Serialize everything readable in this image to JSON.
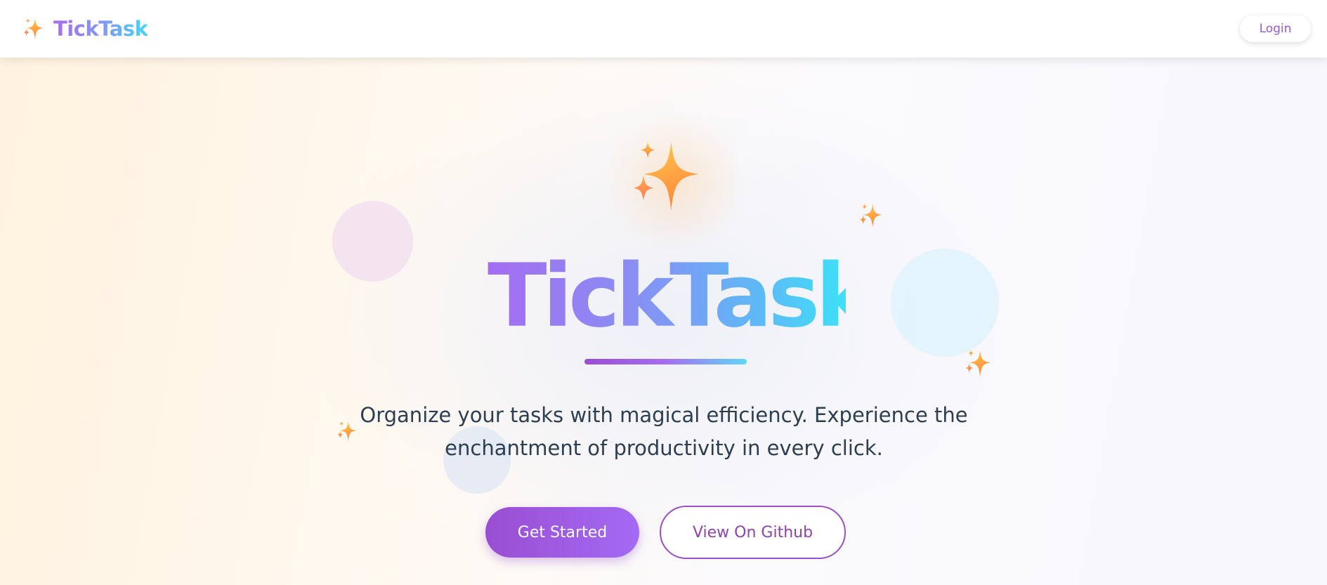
{
  "header": {
    "brand_name": "TickTask",
    "login_label": "Login"
  },
  "hero": {
    "title": "TickTask",
    "subtitle_line1": "Organize your tasks with magical efficiency. Experience the",
    "subtitle_line2": "enchantment of productivity in every click."
  },
  "actions": {
    "primary_label": "Get Started",
    "secondary_label": "View On Github"
  },
  "icons": {
    "brand": "sparkles-icon",
    "hero": "sparkles-icon",
    "decor": [
      "sparkles-icon",
      "sparkles-icon",
      "sparkles-icon"
    ]
  },
  "colors": {
    "accent_purple": "#9b59d6",
    "accent_cyan": "#47d4f7",
    "text_dark": "#2c3e50",
    "sparkle_orange": "#ffa63a"
  }
}
